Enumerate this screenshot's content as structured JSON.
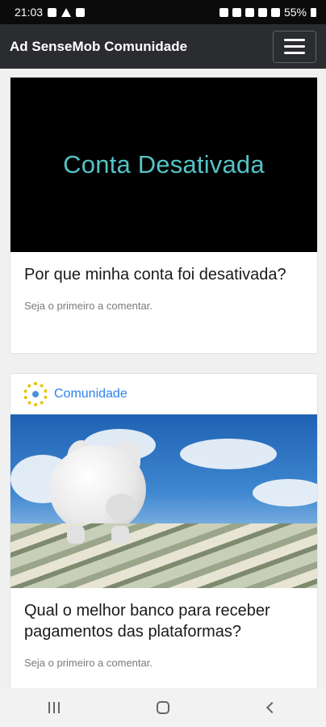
{
  "status_bar": {
    "time": "21:03",
    "battery": "55%"
  },
  "app_bar": {
    "title": "Ad SenseMob Comunidade"
  },
  "feed": {
    "posts": [
      {
        "image_text": "Conta Desativada",
        "title": "Por que minha conta foi desativada?",
        "meta": "Seja o primeiro a comentar."
      },
      {
        "community": "Comunidade",
        "title": "Qual o melhor banco para receber pagamentos das plataformas?",
        "meta": "Seja o primeiro a comentar."
      }
    ]
  },
  "icons": {
    "menu": "hamburger-icon",
    "nav_recent": "recent-apps-icon",
    "nav_home": "home-icon",
    "nav_back": "back-icon"
  },
  "colors": {
    "app_bar": "#2b2c2f",
    "accent_link": "#2f80ed",
    "thumb_text": "#54c2c6"
  }
}
